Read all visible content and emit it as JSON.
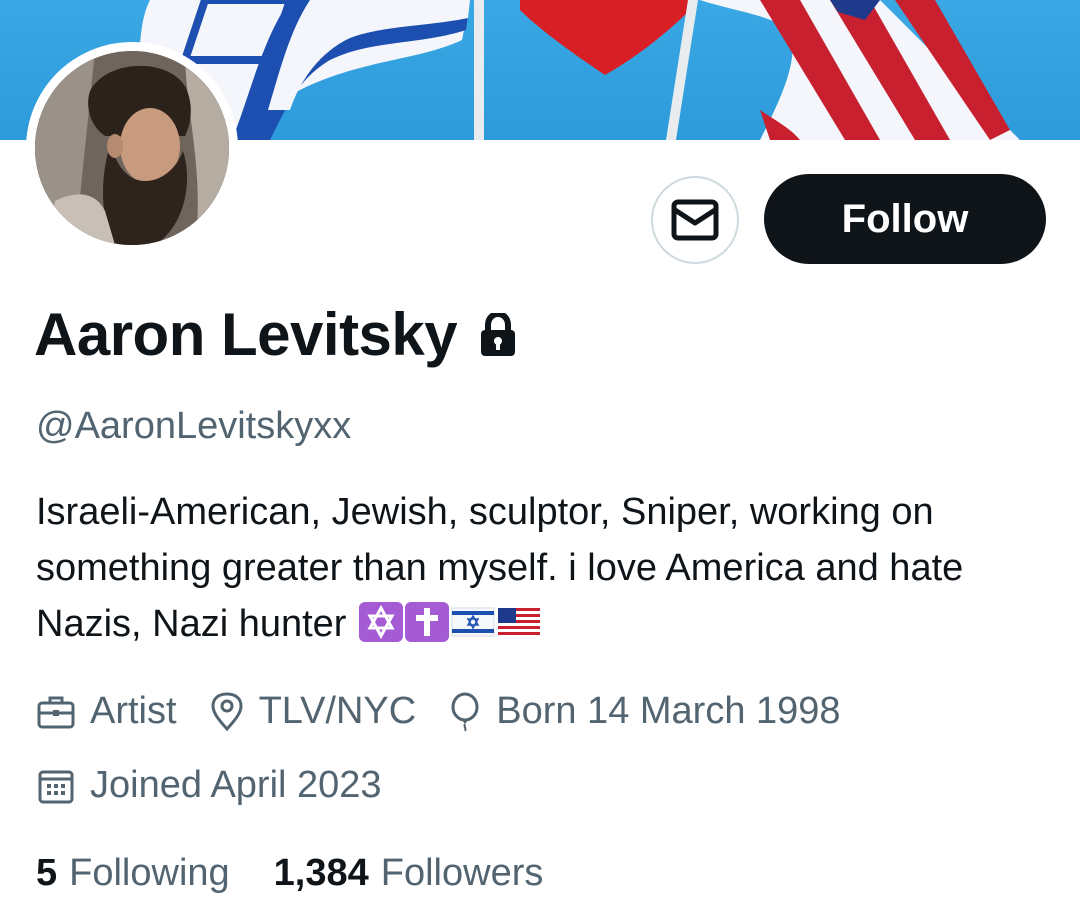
{
  "profile": {
    "name": "Aaron Levitsky",
    "handle": "@AaronLevitskyxx",
    "bio_text": "Israeli-American, Jewish,  sculptor, Sniper, working on something greater than myself. i love America and hate Nazis, Nazi hunter",
    "bio_emojis": [
      "star-of-david-emoji",
      "latin-cross-emoji",
      "israel-flag-emoji",
      "us-flag-emoji"
    ],
    "protected_icon": "lock-icon"
  },
  "actions": {
    "message_icon": "envelope-icon",
    "follow_label": "Follow"
  },
  "meta": {
    "profession": "Artist",
    "location": "TLV/NYC",
    "birthday": "Born 14 March 1998",
    "joined": "Joined April 2023"
  },
  "stats": {
    "following_count": "5",
    "following_label": "Following",
    "followers_count": "1,384",
    "followers_label": "Followers"
  },
  "colors": {
    "text_primary": "#0f1419",
    "text_secondary": "#536471",
    "button_dark": "#0f1419",
    "banner_sky": "#3aa8e4"
  }
}
